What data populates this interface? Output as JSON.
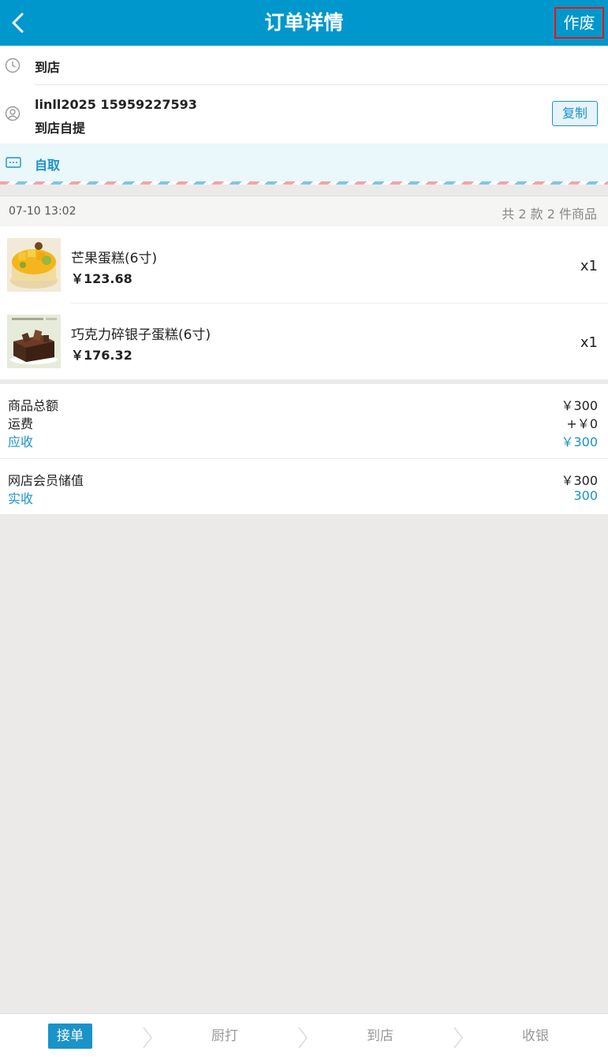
{
  "header": {
    "title": "订单详情",
    "void_label": "作废"
  },
  "customer": {
    "order_type": "到店",
    "name_phone": "linll2025 15959227593",
    "delivery_method": "到店自提",
    "copy_label": "复制",
    "pickup_label": "自取"
  },
  "order": {
    "time": "07-10 13:02",
    "count_text": "共 2 款 2 件商品",
    "items": [
      {
        "name": "芒果蛋糕(6寸)",
        "price": "￥123.68",
        "qty": "x1"
      },
      {
        "name": "巧克力碎银子蛋糕(6寸)",
        "price": "￥176.32",
        "qty": "x1"
      }
    ]
  },
  "totals": {
    "subtotal_label": "商品总额",
    "subtotal_value": "￥300",
    "shipping_label": "运费",
    "shipping_value": "+￥0",
    "receivable_label": "应收",
    "receivable_value": "￥300"
  },
  "payment": {
    "method_label": "网店会员储值",
    "method_value": "￥300",
    "received_label": "实收",
    "received_value": "300"
  },
  "steps": [
    {
      "label": "接单",
      "active": true
    },
    {
      "label": "厨打",
      "active": false
    },
    {
      "label": "到店",
      "active": false
    },
    {
      "label": "收银",
      "active": false
    }
  ],
  "colors": {
    "header": "#0097cc",
    "accent": "#1a93c9",
    "highlight_border": "#e01818"
  },
  "icons": [
    "back-icon",
    "clock-icon",
    "user-icon",
    "message-icon",
    "red-arrow-icon",
    "chevron-right-icon"
  ]
}
